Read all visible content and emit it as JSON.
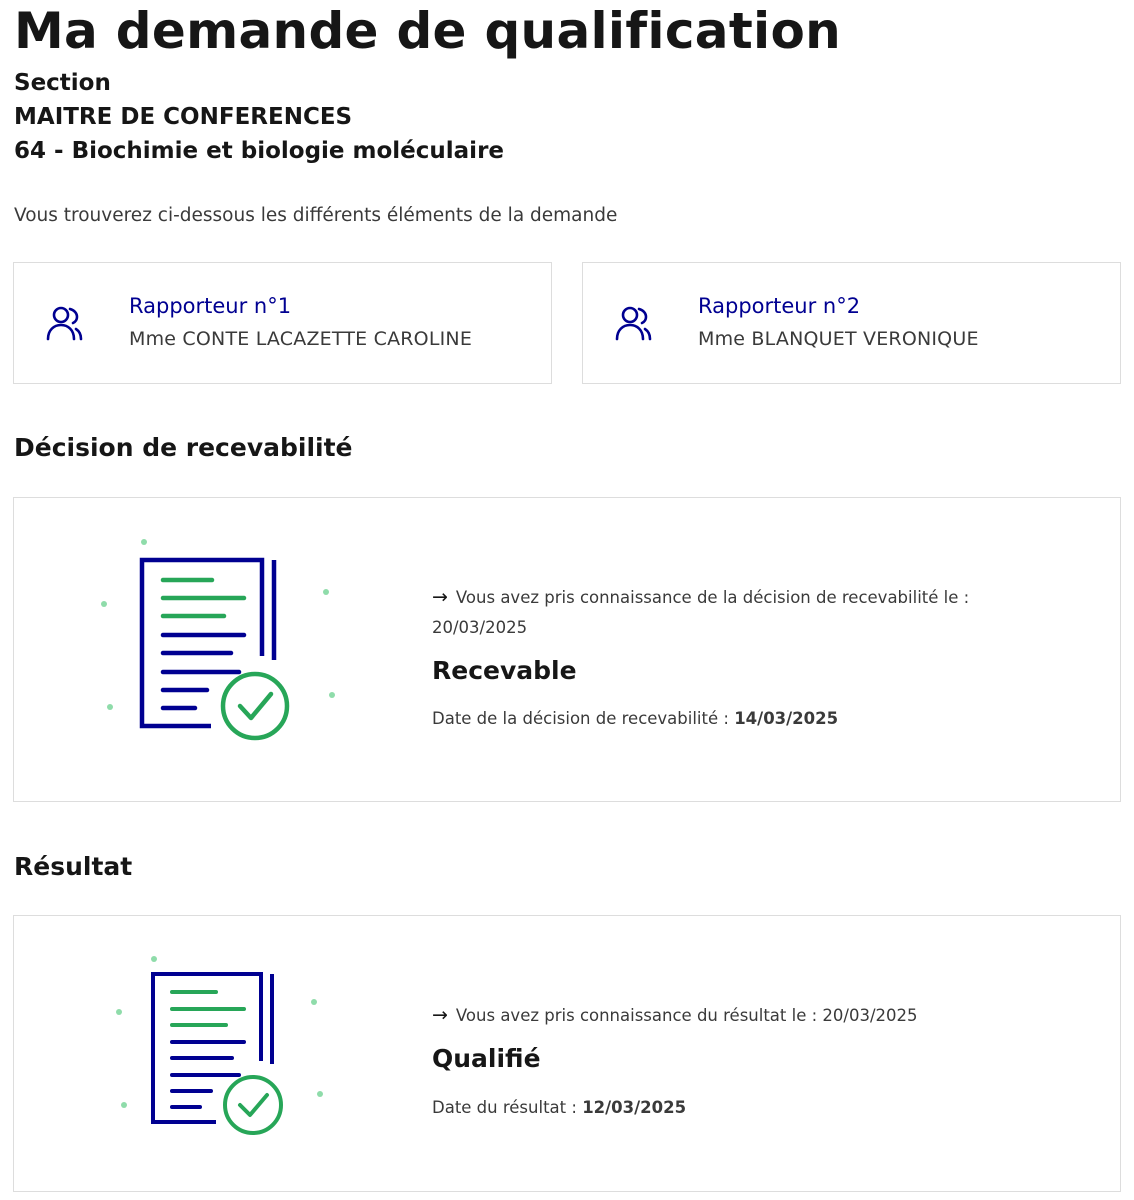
{
  "page": {
    "title": "Ma demande de qualification",
    "section_label": "Section",
    "corps": "MAITRE DE CONFERENCES",
    "section_name": "64 - Biochimie et biologie moléculaire",
    "intro": "Vous trouverez ci-dessous les différents éléments de la demande"
  },
  "rapporteurs": [
    {
      "title": "Rapporteur n°1",
      "name": "Mme CONTE LACAZETTE CAROLINE",
      "icon": "users-icon"
    },
    {
      "title": "Rapporteur n°2",
      "name": "Mme BLANQUET VERONIQUE",
      "icon": "users-icon"
    }
  ],
  "recevabilite": {
    "heading": "Décision de recevabilité",
    "ack_text": "Vous avez pris connaissance de la décision de recevabilité le :",
    "ack_date": "20/03/2025",
    "status": "Recevable",
    "date_label": "Date de la décision de recevabilité :",
    "date_value": "14/03/2025",
    "icon": "document-check-icon"
  },
  "resultat": {
    "heading": "Résultat",
    "ack_text": "Vous avez pris connaissance du résultat le : 20/03/2025",
    "status": "Qualifié",
    "date_label": "Date du résultat :",
    "date_value": "12/03/2025",
    "icon": "document-check-icon"
  },
  "colors": {
    "primary_blue": "#000091",
    "success_green": "#27a658",
    "text": "#161616",
    "muted_text": "#3a3a3a",
    "border": "#dddddd"
  }
}
